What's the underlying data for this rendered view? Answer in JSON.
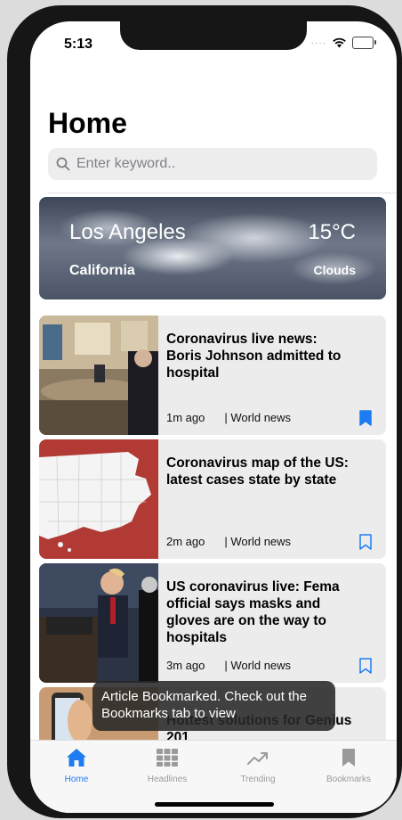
{
  "status": {
    "time": "5:13"
  },
  "page": {
    "title": "Home"
  },
  "search": {
    "placeholder": "Enter keyword.."
  },
  "weather": {
    "city": "Los Angeles",
    "state": "California",
    "temperature": "15°C",
    "condition": "Clouds"
  },
  "articles": [
    {
      "headline": "Coronavirus live news: Boris Johnson admitted to hospital",
      "time": "1m ago",
      "category": "| World news",
      "bookmarked": true
    },
    {
      "headline": "Coronavirus map of the US: latest cases state by state",
      "time": "2m ago",
      "category": "| World news",
      "bookmarked": false
    },
    {
      "headline": "US coronavirus live: Fema official says masks and gloves are on the way to hospitals",
      "time": "3m ago",
      "category": "| World news",
      "bookmarked": false
    },
    {
      "headline": "Hottest solutions for Genius 201",
      "time": "",
      "category": "",
      "bookmarked": false
    }
  ],
  "toast": {
    "message": "Article Bookmarked. Check out the Bookmarks tab to view"
  },
  "tabs": [
    {
      "label": "Home",
      "icon": "home-icon",
      "active": true
    },
    {
      "label": "Headlines",
      "icon": "grid-icon",
      "active": false
    },
    {
      "label": "Trending",
      "icon": "trending-icon",
      "active": false
    },
    {
      "label": "Bookmarks",
      "icon": "bookmark-icon",
      "active": false
    }
  ],
  "colors": {
    "accent": "#1d7cf2",
    "inactive": "#9a9a9a"
  }
}
